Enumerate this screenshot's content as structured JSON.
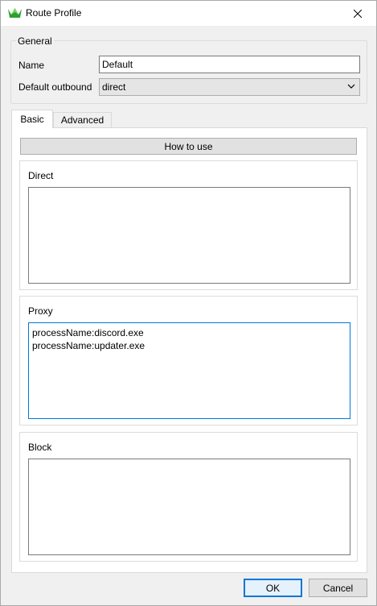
{
  "window": {
    "title": "Route Profile",
    "close_glyph": "✕",
    "brand_color": "#2ca033"
  },
  "general": {
    "group_title": "General",
    "name_label": "Name",
    "name_value": "Default",
    "outbound_label": "Default outbound",
    "outbound_value": "direct"
  },
  "tabs": [
    {
      "label": "Basic",
      "selected": true
    },
    {
      "label": "Advanced",
      "selected": false
    }
  ],
  "basic": {
    "how_to_use_label": "How to use",
    "direct": {
      "title": "Direct",
      "lines": []
    },
    "proxy": {
      "title": "Proxy",
      "lines": [
        "processName:discord.exe",
        "processName:updater.exe"
      ]
    },
    "block": {
      "title": "Block",
      "lines": []
    }
  },
  "footer": {
    "ok_label": "OK",
    "cancel_label": "Cancel"
  },
  "icons": {
    "app": "crown-icon",
    "close": "close-icon",
    "dropdown": "chevron-down-icon"
  }
}
